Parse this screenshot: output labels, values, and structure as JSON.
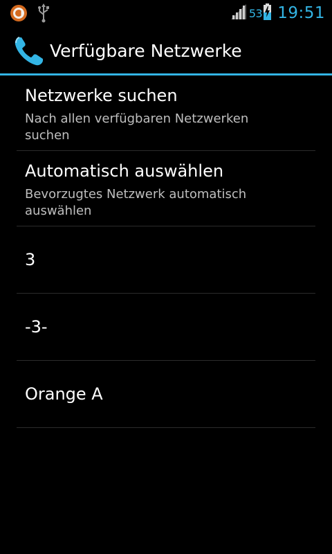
{
  "status_bar": {
    "battery_percent": "53",
    "time": "19:51",
    "icons": [
      "avast-icon",
      "usb-icon",
      "signal-icon",
      "battery-charging-icon"
    ]
  },
  "action_bar": {
    "title": "Verfügbare Netzwerke",
    "icon": "phone-icon"
  },
  "list": {
    "search": {
      "title": "Netzwerke suchen",
      "summary": "Nach allen verfügbaren Netzwerken suchen"
    },
    "auto": {
      "title": "Automatisch auswählen",
      "summary": "Bevorzugtes Netzwerk automatisch auswählen"
    },
    "networks": [
      {
        "name": "3"
      },
      {
        "name": "-3-"
      },
      {
        "name": "Orange A"
      }
    ]
  },
  "colors": {
    "accent": "#33b5e5",
    "background": "#000000",
    "divider": "#2c2c2c",
    "secondary_text": "#bfbfbf"
  }
}
